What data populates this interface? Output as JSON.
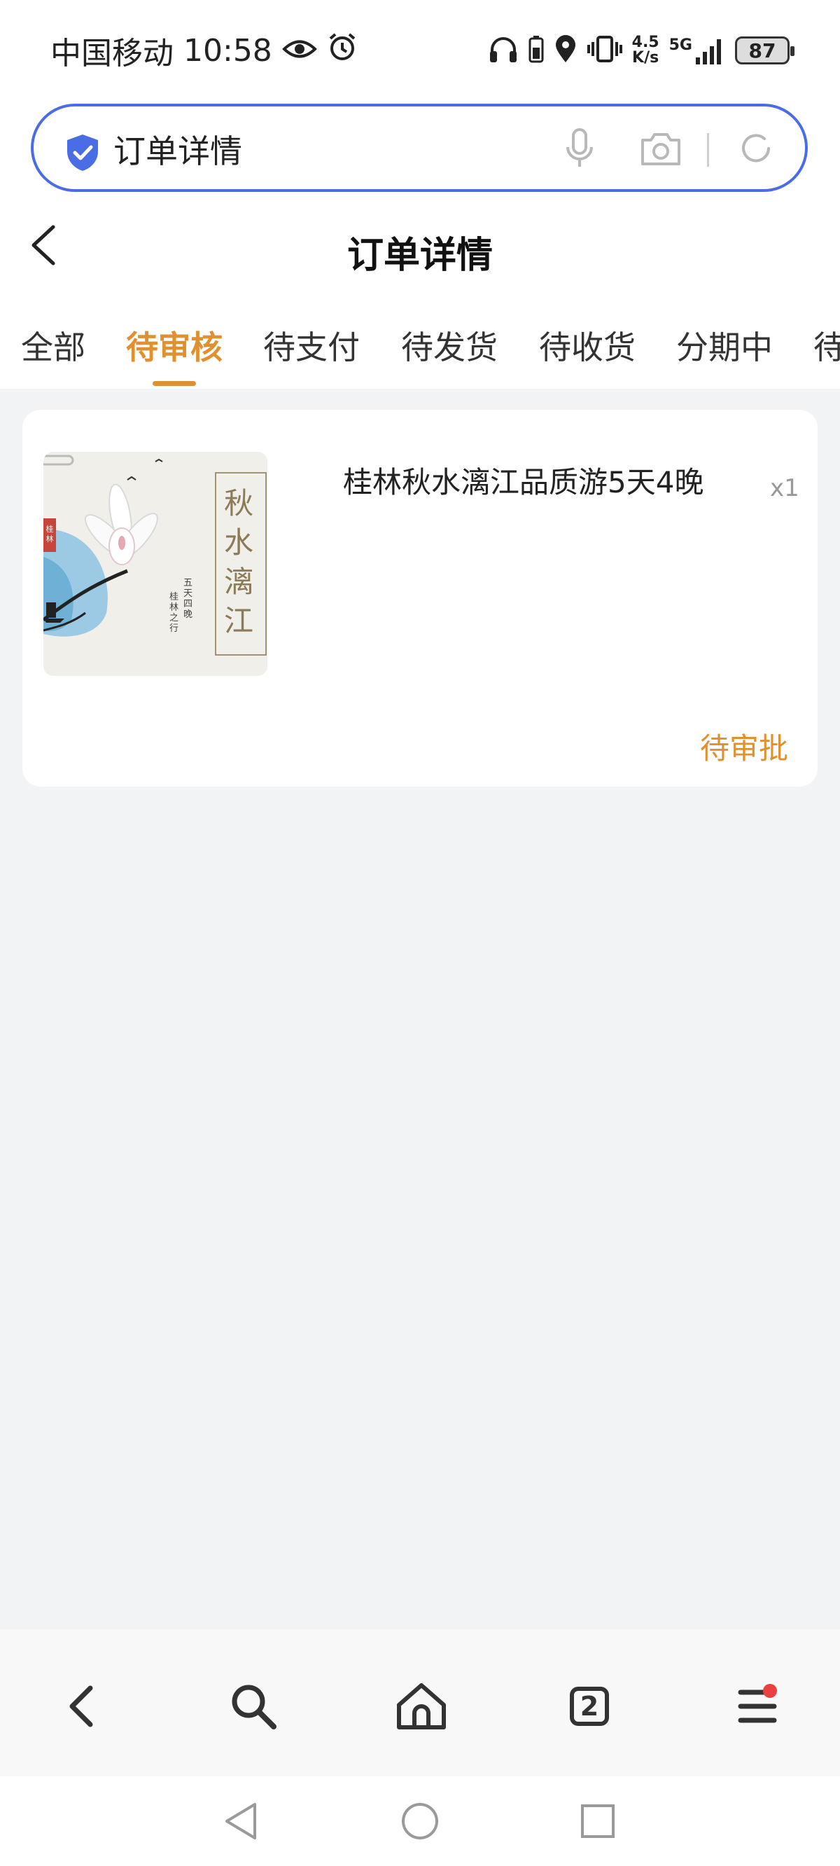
{
  "status_bar": {
    "carrier": "中国移动",
    "time": "10:58",
    "net_speed_value": "4.5",
    "net_speed_unit": "K/s",
    "network": "5G",
    "battery": "87"
  },
  "browser": {
    "address_text": "订单详情"
  },
  "header": {
    "title": "订单详情"
  },
  "tabs": [
    {
      "label": "全部"
    },
    {
      "label": "待审核",
      "active": true
    },
    {
      "label": "待支付"
    },
    {
      "label": "待发货"
    },
    {
      "label": "待收货"
    },
    {
      "label": "分期中"
    },
    {
      "label": "待"
    }
  ],
  "order": {
    "product_name": "桂林秋水漓江品质游5天4晚",
    "quantity": "x1",
    "status": "待审批",
    "thumbnail": {
      "title": "秋水漓江",
      "subtitle_1": "五天四晚",
      "subtitle_2": "桂林之行",
      "seal": "桂林"
    }
  },
  "bottom_nav": {
    "tab_count": "2"
  },
  "colors": {
    "accent": "#e0902e",
    "browser_blue": "#4a6de5",
    "background": "#f2f3f5"
  }
}
